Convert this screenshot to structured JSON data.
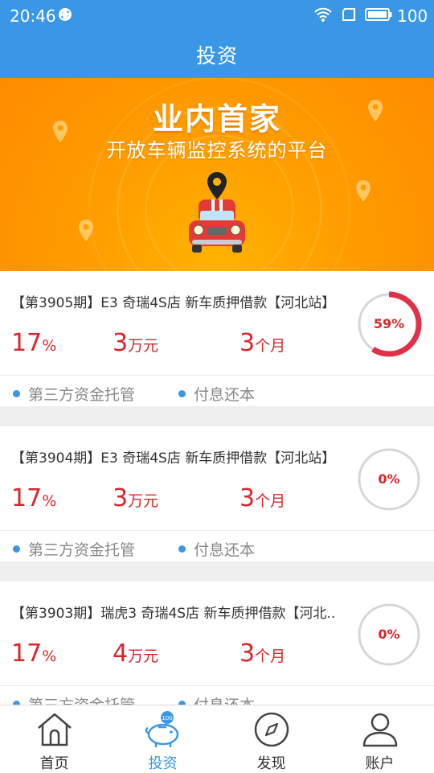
{
  "status_bar": {
    "time": "20:46",
    "battery": "100"
  },
  "header": {
    "title": "投资"
  },
  "banner": {
    "headline": "业内首家",
    "subline": "开放车辆监控系统的平台"
  },
  "loans": [
    {
      "name": "【第3905期】E3 奇瑞4S店 新车质押借款【河北站】",
      "rate": "17",
      "rate_unit": "%",
      "amount": "3",
      "amount_unit": "万元",
      "term": "3",
      "term_unit": "个月",
      "tag1": "第三方资金托管",
      "tag2": "付息还本",
      "progress_label": "59%",
      "progress": 0.59
    },
    {
      "name": "【第3904期】E3 奇瑞4S店 新车质押借款【河北站】",
      "rate": "17",
      "rate_unit": "%",
      "amount": "3",
      "amount_unit": "万元",
      "term": "3",
      "term_unit": "个月",
      "tag1": "第三方资金托管",
      "tag2": "付息还本",
      "progress_label": "0%",
      "progress": 0
    },
    {
      "name": "【第3903期】瑞虎3 奇瑞4S店 新车质押借款【河北..",
      "rate": "17",
      "rate_unit": "%",
      "amount": "4",
      "amount_unit": "万元",
      "term": "3",
      "term_unit": "个月",
      "tag1": "第三方资金托管",
      "tag2": "付息还本",
      "progress_label": "0%",
      "progress": 0
    }
  ],
  "tabbar": {
    "home": "首页",
    "invest": "投资",
    "invest_badge": "100",
    "discover": "发现",
    "account": "账户"
  },
  "colors": {
    "primary": "#3a97e6",
    "accent_red": "#d9262a",
    "banner_orange": "#ff9d00"
  }
}
